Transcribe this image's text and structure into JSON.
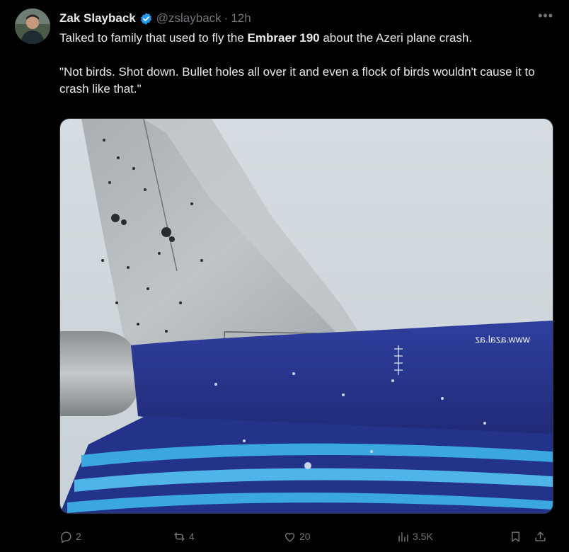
{
  "author": {
    "display_name": "Zak Slayback",
    "handle": "@zslayback",
    "separator": "·",
    "time": "12h"
  },
  "tweet": {
    "line1_before": "Talked to family that used to fly the ",
    "line1_bold": "Embraer 190",
    "line1_after": " about the Azeri plane crash.",
    "quote": "\"Not birds. Shot down. Bullet holes all over it and even a flock of birds wouldn't cause it to crash like that.\""
  },
  "media": {
    "livery_text": "www.azal.az"
  },
  "actions": {
    "replies": "2",
    "reposts": "4",
    "likes": "20",
    "views": "3.5K"
  },
  "icons": {
    "verified": "verified-badge-icon",
    "more": "more-icon",
    "reply": "reply-icon",
    "repost": "repost-icon",
    "like": "heart-icon",
    "views": "views-icon",
    "bookmark": "bookmark-icon",
    "share": "share-icon"
  },
  "colors": {
    "background": "#000000",
    "text": "#e7e9ea",
    "muted": "#71767b",
    "verified": "#1d9bf0"
  }
}
